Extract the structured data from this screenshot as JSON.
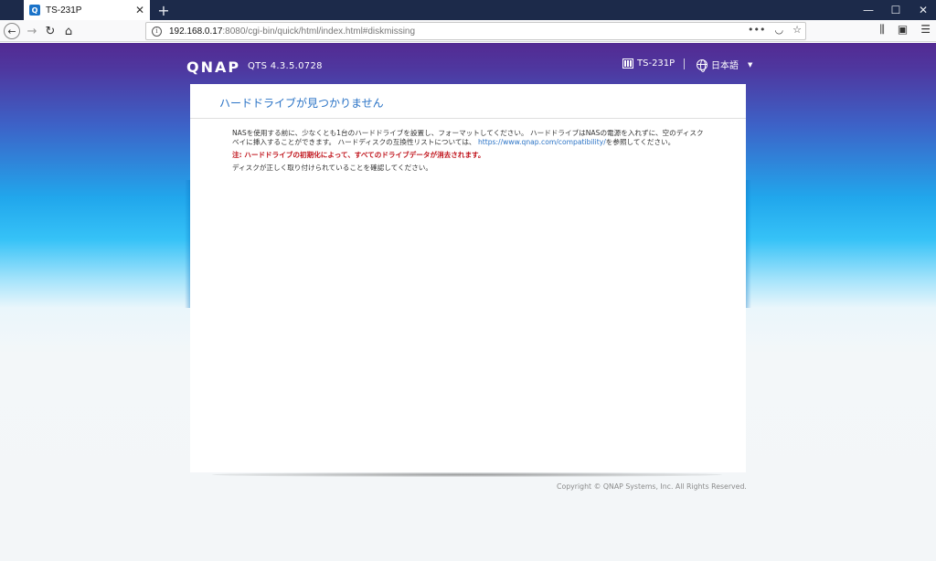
{
  "browser": {
    "tab_title": "TS-231P",
    "tab_favicon": "Q",
    "url_host": "192.168.0.17",
    "url_rest": ":8080/cgi-bin/quick/html/index.html#diskmissing",
    "url_menu": "•••"
  },
  "header": {
    "logo": "QNAP",
    "version": "QTS 4.3.5.0728",
    "model": "TS-231P",
    "language": "日本語"
  },
  "card": {
    "title": "ハードドライブが見つかりません",
    "para1_text": "NASを使用する前に、少なくとも1台のハードドライブを設置し、フォーマットしてください。 ハードドライブはNASの電源を入れずに、空のディスクベイに挿入することができます。 ハードディスクの互換性リストについては、 ",
    "para1_link": "https://www.qnap.com/compatibility/",
    "para1_suffix": "を参照してください。",
    "warning": "注: ハードドライブの初期化によって、すべてのドライブデータが消去されます。",
    "para3": "ディスクが正しく取り付けられていることを確認してください。"
  },
  "footer": {
    "copyright": "Copyright © QNAP Systems, Inc. All Rights Reserved."
  },
  "colors": {
    "accent": "#2a73c6",
    "warning": "#c0141c",
    "header_purple": "#532a92",
    "sky_blue": "#21a7ec"
  }
}
